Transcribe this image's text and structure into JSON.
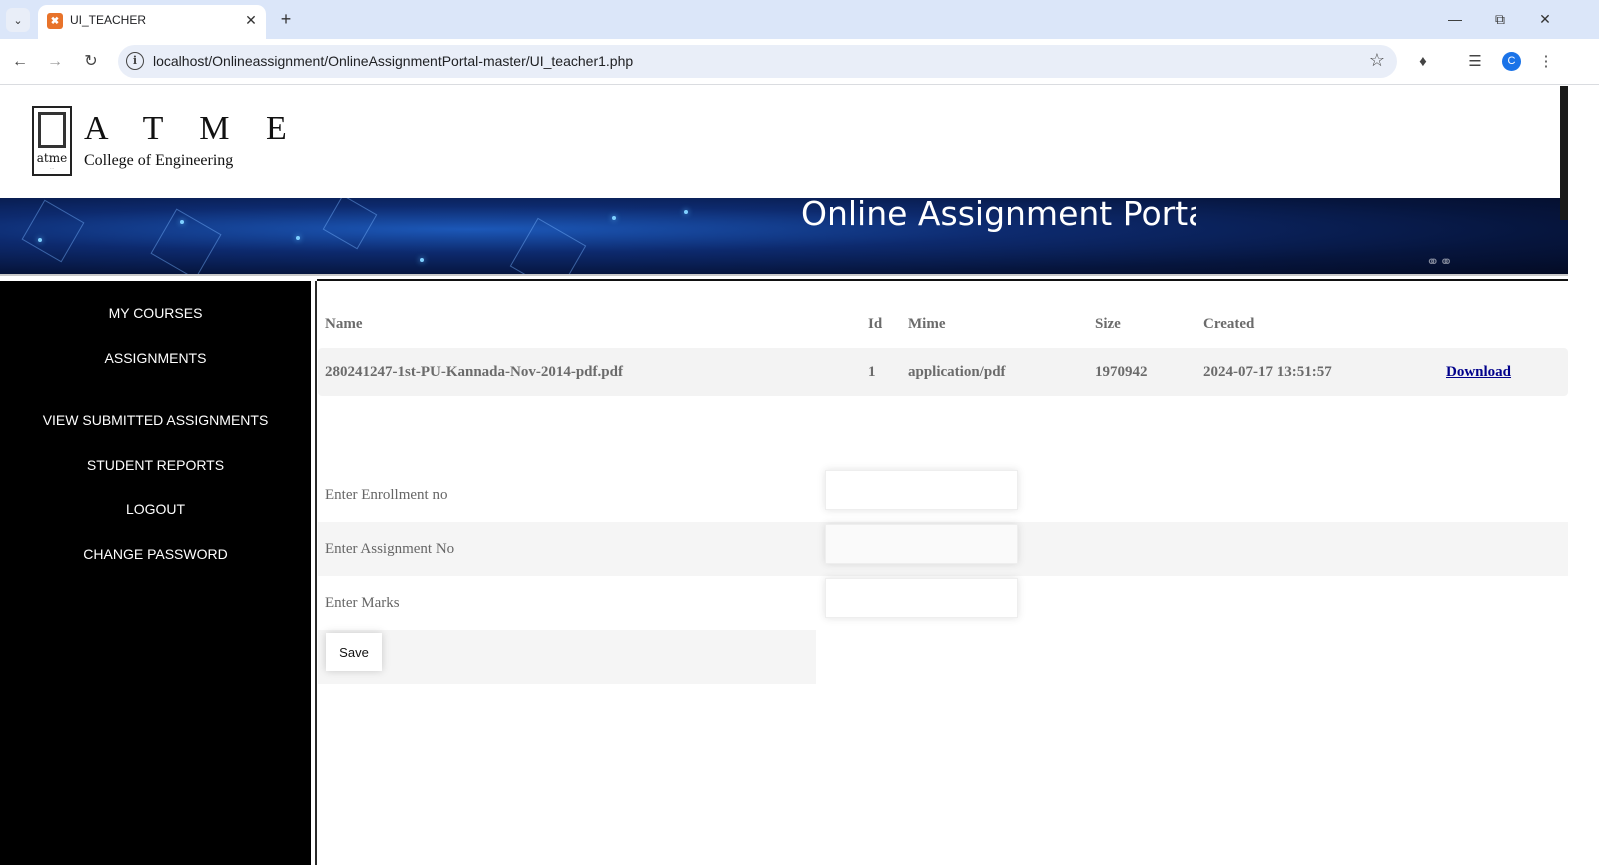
{
  "browser": {
    "tab_title": "UI_TEACHER",
    "url": "localhost/Onlineassignment/OnlineAssignmentPortal-master/UI_teacher1.php",
    "avatar_letter": "C"
  },
  "header": {
    "logo_name": "A T M E",
    "logo_sub": "atme",
    "college_name": "College of Engineering",
    "banner_title": "Online Assignment Portal"
  },
  "sidebar": {
    "items": [
      {
        "label": "MY COURSES"
      },
      {
        "label": "ASSIGNMENTS"
      },
      {
        "label": "VIEW SUBMITTED ASSIGNMENTS"
      },
      {
        "label": "STUDENT REPORTS"
      },
      {
        "label": "LOGOUT"
      },
      {
        "label": "CHANGE PASSWORD"
      }
    ]
  },
  "table": {
    "headers": {
      "name": "Name",
      "id": "Id",
      "mime": "Mime",
      "size": "Size",
      "created": "Created"
    },
    "rows": [
      {
        "name": "280241247-1st-PU-Kannada-Nov-2014-pdf.pdf",
        "id": "1",
        "mime": "application/pdf",
        "size": "1970942",
        "created": "2024-07-17 13:51:57",
        "action": "Download"
      }
    ]
  },
  "form": {
    "enrollment_label": "Enter Enrollment no",
    "enrollment_value": "",
    "assignment_label": "Enter Assignment No",
    "assignment_value": "",
    "marks_label": "Enter Marks",
    "marks_value": "",
    "save_label": "Save"
  }
}
